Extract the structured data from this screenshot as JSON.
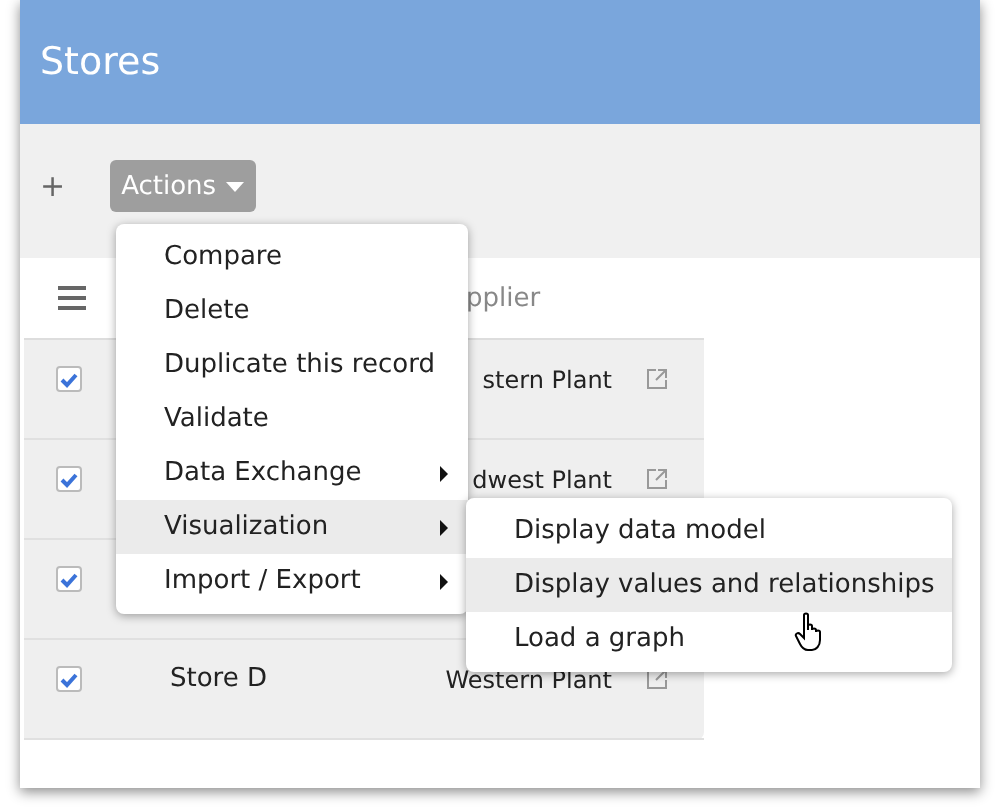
{
  "window": {
    "title": "Stores"
  },
  "toolbar": {
    "add": "+",
    "actions": "Actions"
  },
  "table": {
    "columns": [
      {
        "label": "pplier"
      }
    ],
    "rows": [
      {
        "checked": true,
        "store": "",
        "supplier": "stern Plant",
        "link": true
      },
      {
        "checked": true,
        "store": "",
        "supplier": "dwest Plant",
        "link": true
      },
      {
        "checked": true,
        "store": "",
        "supplier": "",
        "link": false
      },
      {
        "checked": true,
        "store": "Store D",
        "supplier": "Western Plant",
        "link": true
      }
    ]
  },
  "actions_menu": {
    "items": [
      {
        "label": "Compare",
        "kind": "item",
        "selected": false
      },
      {
        "label": "Delete",
        "kind": "item",
        "selected": false
      },
      {
        "label": "Duplicate this record",
        "kind": "item",
        "selected": false
      },
      {
        "label": "Validate",
        "kind": "item",
        "selected": false
      },
      {
        "label": "Data Exchange",
        "kind": "submenu",
        "selected": false
      },
      {
        "label": "Visualization",
        "kind": "submenu",
        "selected": true
      },
      {
        "label": "Import / Export",
        "kind": "submenu",
        "selected": false
      }
    ]
  },
  "submenu": {
    "items": [
      {
        "label": "Display data model",
        "selected": false
      },
      {
        "label": "Display values and relationships",
        "selected": true
      },
      {
        "label": "Load a graph",
        "selected": false
      }
    ]
  }
}
